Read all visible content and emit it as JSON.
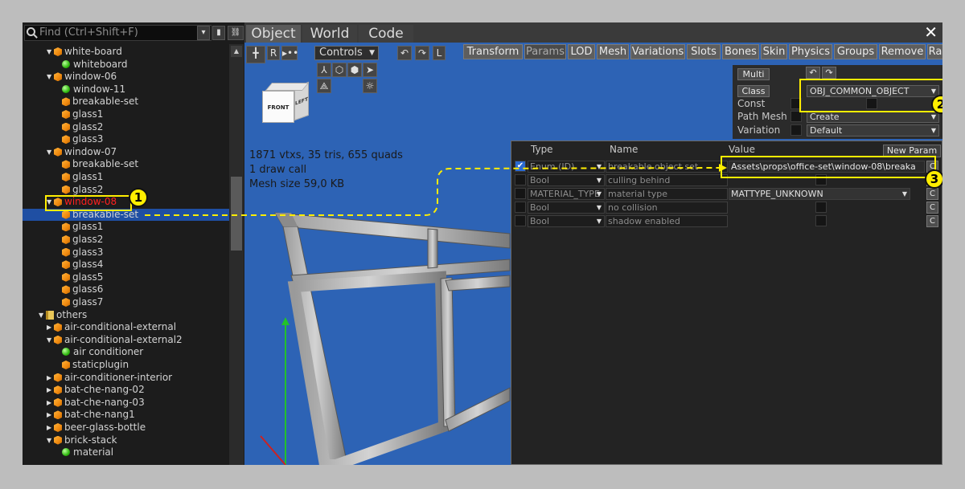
{
  "search": {
    "placeholder": "Find (Ctrl+Shift+F)"
  },
  "tree": [
    {
      "label": "white-board",
      "icon": "cube",
      "arrow": "down",
      "indent": 2
    },
    {
      "label": "whiteboard",
      "icon": "dot",
      "arrow": "",
      "indent": 3
    },
    {
      "label": "window-06",
      "icon": "cube",
      "arrow": "down",
      "indent": 2
    },
    {
      "label": "window-11",
      "icon": "dot",
      "arrow": "",
      "indent": 3
    },
    {
      "label": "breakable-set",
      "icon": "cube",
      "arrow": "",
      "indent": 3
    },
    {
      "label": "glass1",
      "icon": "cube",
      "arrow": "",
      "indent": 3
    },
    {
      "label": "glass2",
      "icon": "cube",
      "arrow": "",
      "indent": 3
    },
    {
      "label": "glass3",
      "icon": "cube",
      "arrow": "",
      "indent": 3
    },
    {
      "label": "window-07",
      "icon": "cube",
      "arrow": "down",
      "indent": 2
    },
    {
      "label": "breakable-set",
      "icon": "cube",
      "arrow": "",
      "indent": 3
    },
    {
      "label": "glass1",
      "icon": "cube",
      "arrow": "",
      "indent": 3
    },
    {
      "label": "glass2",
      "icon": "cube",
      "arrow": "",
      "indent": 3
    },
    {
      "label": "window-08",
      "icon": "cube",
      "arrow": "down",
      "indent": 2,
      "state": "highlighted"
    },
    {
      "label": "breakable-set",
      "icon": "cube",
      "arrow": "",
      "indent": 3,
      "state": "selected"
    },
    {
      "label": "glass1",
      "icon": "cube",
      "arrow": "",
      "indent": 3
    },
    {
      "label": "glass2",
      "icon": "cube",
      "arrow": "",
      "indent": 3
    },
    {
      "label": "glass3",
      "icon": "cube",
      "arrow": "",
      "indent": 3
    },
    {
      "label": "glass4",
      "icon": "cube",
      "arrow": "",
      "indent": 3
    },
    {
      "label": "glass5",
      "icon": "cube",
      "arrow": "",
      "indent": 3
    },
    {
      "label": "glass6",
      "icon": "cube",
      "arrow": "",
      "indent": 3
    },
    {
      "label": "glass7",
      "icon": "cube",
      "arrow": "",
      "indent": 3
    },
    {
      "label": "others",
      "icon": "folder",
      "arrow": "down",
      "indent": 1
    },
    {
      "label": "air-conditional-external",
      "icon": "cube",
      "arrow": "right",
      "indent": 2
    },
    {
      "label": "air-conditional-external2",
      "icon": "cube",
      "arrow": "down",
      "indent": 2
    },
    {
      "label": "air conditioner",
      "icon": "dot",
      "arrow": "",
      "indent": 3
    },
    {
      "label": "staticplugin",
      "icon": "cube",
      "arrow": "",
      "indent": 3
    },
    {
      "label": "air-conditioner-interior",
      "icon": "cube",
      "arrow": "right",
      "indent": 2
    },
    {
      "label": "bat-che-nang-02",
      "icon": "cube",
      "arrow": "right",
      "indent": 2
    },
    {
      "label": "bat-che-nang-03",
      "icon": "cube",
      "arrow": "right",
      "indent": 2
    },
    {
      "label": "bat-che-nang1",
      "icon": "cube",
      "arrow": "right",
      "indent": 2
    },
    {
      "label": "beer-glass-bottle",
      "icon": "cube",
      "arrow": "right",
      "indent": 2
    },
    {
      "label": "brick-stack",
      "icon": "cube",
      "arrow": "down",
      "indent": 2
    },
    {
      "label": "material",
      "icon": "dot",
      "arrow": "",
      "indent": 3
    }
  ],
  "mode_tabs": [
    "Object",
    "World",
    "Code"
  ],
  "viewport": {
    "controls_label": "Controls",
    "r_label": "R",
    "l_label": "L",
    "cube_front": "FRONT",
    "cube_left": "LEFT",
    "stats": [
      "1871 vtxs, 35 tris, 655 quads",
      "1 draw call",
      "Mesh size 59,0 KB"
    ]
  },
  "prop_tabs": [
    {
      "label": "Transform",
      "dim": false
    },
    {
      "label": "Params",
      "dim": true
    },
    {
      "label": "LOD",
      "dim": false
    },
    {
      "label": "Mesh",
      "dim": false
    },
    {
      "label": "Variations",
      "dim": false
    },
    {
      "label": "Slots",
      "dim": false
    },
    {
      "label": "Bones",
      "dim": false
    },
    {
      "label": "Skin",
      "dim": false
    },
    {
      "label": "Physics",
      "dim": false
    },
    {
      "label": "Groups",
      "dim": false
    },
    {
      "label": "Remove",
      "dim": false
    },
    {
      "label": "Ra",
      "dim": false
    }
  ],
  "object_panel": {
    "multi": "Multi",
    "class_btn": "Class",
    "class_value": "OBJ_COMMON_OBJECT",
    "const": "Const",
    "path_mesh": "Path Mesh",
    "path_mesh_value": "Create",
    "variation": "Variation",
    "variation_value": "Default"
  },
  "params": {
    "headers": {
      "type": "Type",
      "name": "Name",
      "value": "Value"
    },
    "new_param": "New Param",
    "rows": [
      {
        "type": "Enum (ID)",
        "name": "breakable object set",
        "value": "Assets\\props\\office-set\\window-08\\breaka",
        "kind": "text",
        "checked": true
      },
      {
        "type": "Bool",
        "name": "culling behind",
        "value": "",
        "kind": "bool",
        "checked": false
      },
      {
        "type": "MATERIAL_TYPE",
        "name": "material type",
        "value": "MATTYPE_UNKNOWN",
        "kind": "enum",
        "checked": false
      },
      {
        "type": "Bool",
        "name": "no collision",
        "value": "",
        "kind": "bool",
        "checked": false
      },
      {
        "type": "Bool",
        "name": "shadow enabled",
        "value": "",
        "kind": "bool",
        "checked": false
      }
    ],
    "c_label": "C"
  },
  "callouts": [
    "1",
    "2",
    "3"
  ],
  "colors": {
    "accent_callout": "#ffee00",
    "selection": "#1f4fa3",
    "viewport_bg": "#2d63b5",
    "highlight_text": "#ff2020"
  }
}
